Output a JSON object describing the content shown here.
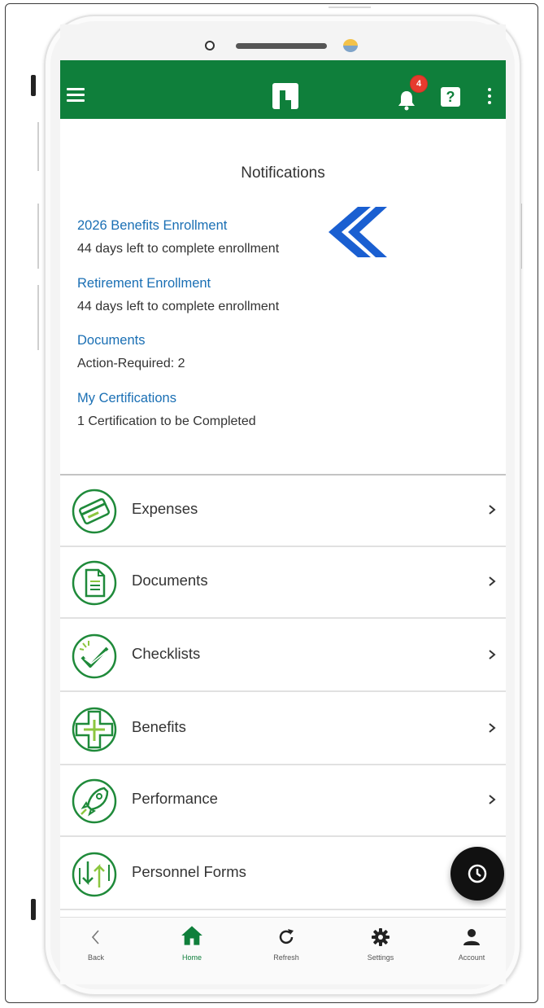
{
  "appbar": {
    "notification_count": "4",
    "help_glyph": "?",
    "icons": [
      "menu-icon",
      "logo-icon",
      "bell-icon",
      "help-icon",
      "more-vert-icon"
    ],
    "color": "#0f7f3b"
  },
  "notifications": {
    "title": "Notifications",
    "items": [
      {
        "link": "2026 Benefits Enrollment",
        "desc": "44 days left to complete enrollment"
      },
      {
        "link": "Retirement Enrollment",
        "desc": "44 days left to complete enrollment"
      },
      {
        "link": "Documents",
        "desc": "Action-Required: 2"
      },
      {
        "link": "My Certifications",
        "desc": "1 Certification to be Completed"
      }
    ],
    "link_color": "#1a6fb4",
    "pointer_color": "#1a5fd1"
  },
  "menu": {
    "items": [
      {
        "label": "Expenses",
        "icon": "credit-card-icon"
      },
      {
        "label": "Documents",
        "icon": "document-icon"
      },
      {
        "label": "Checklists",
        "icon": "checklist-icon"
      },
      {
        "label": "Benefits",
        "icon": "medical-cross-icon"
      },
      {
        "label": "Performance",
        "icon": "rocket-icon"
      },
      {
        "label": "Personnel Forms",
        "icon": "transfer-arrows-icon"
      }
    ],
    "icon_color": "#1f8a3a"
  },
  "fab": {
    "icon": "clock-icon"
  },
  "bottom_nav": {
    "items": [
      {
        "label": "Back",
        "icon": "back-chevron-icon"
      },
      {
        "label": "Home",
        "icon": "home-icon",
        "active": true
      },
      {
        "label": "Refresh",
        "icon": "refresh-icon"
      },
      {
        "label": "Settings",
        "icon": "gear-icon"
      },
      {
        "label": "Account",
        "icon": "person-icon"
      }
    ]
  }
}
